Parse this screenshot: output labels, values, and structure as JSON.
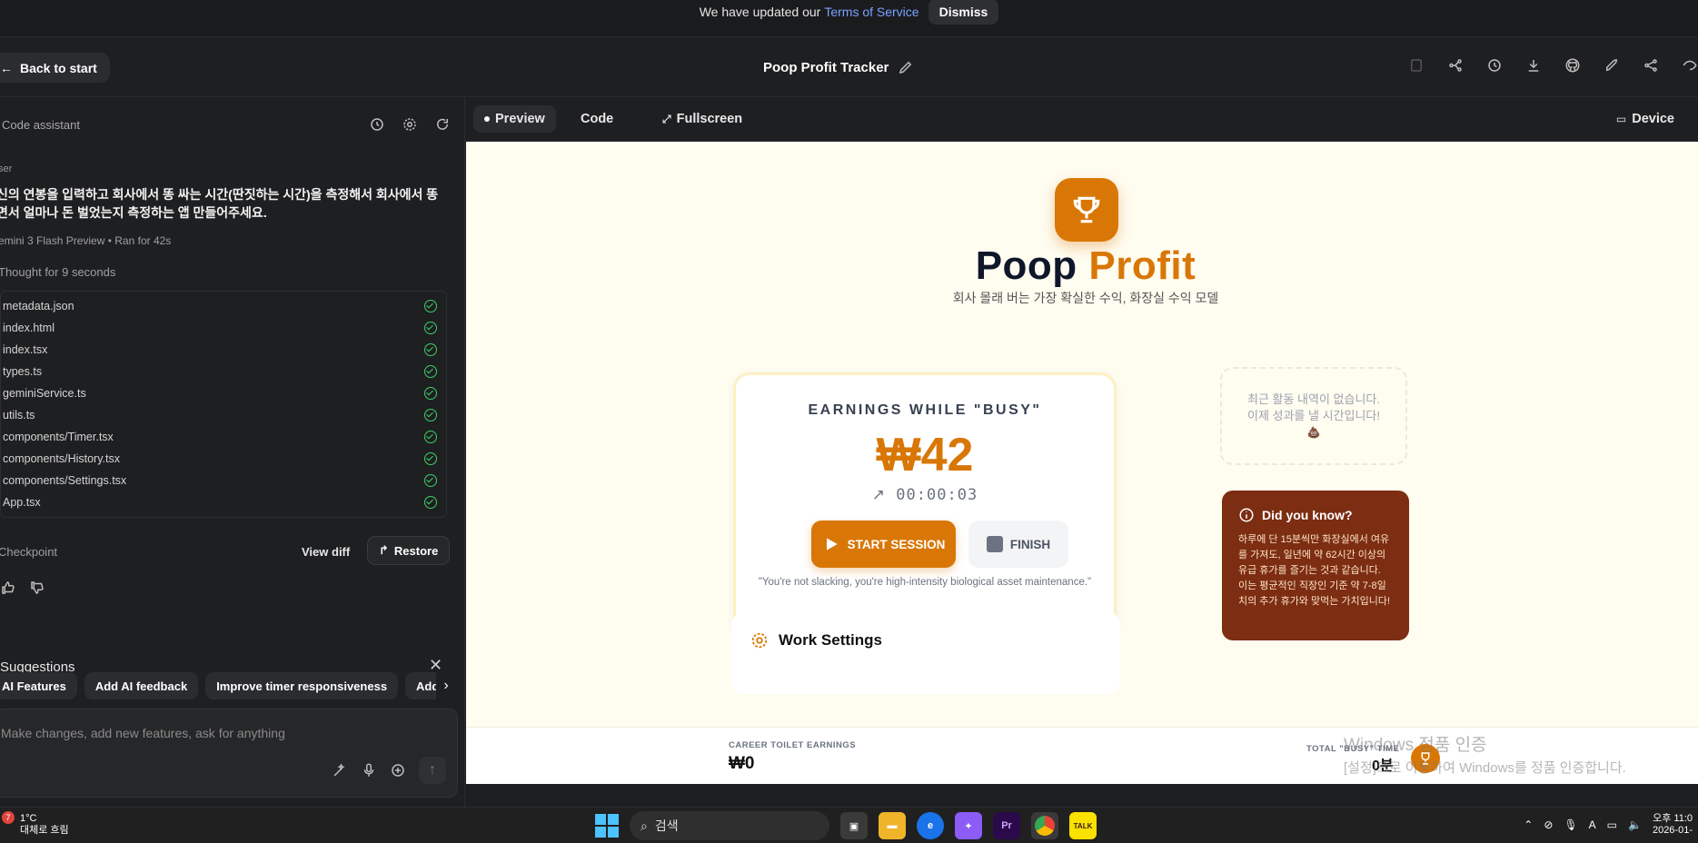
{
  "banner": {
    "text": "We have updated our",
    "link": "Terms of Service",
    "dismiss": "Dismiss"
  },
  "topbar": {
    "back": "Back to start",
    "title": "Poop Profit Tracker"
  },
  "assistant": {
    "title": "Code assistant",
    "user_label": "ser",
    "prompt": "신의 연봉을 입력하고 회사에서 똥 싸는 시간(딴짓하는 시간)을 측정해서 회사에서 똥 면서 얼마나 돈 벌었는지 측정하는 앱 만들어주세요.",
    "model": "emini 3 Flash Preview",
    "ran": "Ran for 42s",
    "thought": "Thought for 9 seconds",
    "files": [
      "metadata.json",
      "index.html",
      "index.tsx",
      "types.ts",
      "geminiService.ts",
      "utils.ts",
      "components/Timer.tsx",
      "components/History.tsx",
      "components/Settings.tsx",
      "App.tsx"
    ],
    "checkpoint": "Checkpoint",
    "view_diff": "View diff",
    "restore": "Restore",
    "suggestions_title": "Suggestions",
    "suggestions": [
      "AI Features",
      "Add AI feedback",
      "Improve timer responsiveness",
      "Add s"
    ],
    "input_placeholder": "Make changes, add new features, ask for anything"
  },
  "preview_tabs": {
    "preview": "Preview",
    "code": "Code",
    "fullscreen": "Fullscreen",
    "device": "Device"
  },
  "app": {
    "title_a": "Poop",
    "title_b": "Profit",
    "subtitle": "회사 몰래 버는 가장 확실한 수익, 화장실 수익 모델",
    "card_label": "EARNINGS WHILE \"BUSY\"",
    "amount": "₩42",
    "elapsed": "00:00:03",
    "start": "START SESSION",
    "finish": "FINISH",
    "quote": "\"You're not slacking, you're high-intensity biological asset maintenance.\"",
    "empty_line1": "최근 활동 내역이 없습니다.",
    "empty_line2": "이제 성과를 낼 시간입니다!",
    "empty_emoji": "💩",
    "did_title": "Did you know?",
    "did_body": "하루에 단 15분씩만 화장실에서 여유를 가져도, 일년에 약 62시간 이상의 유급 휴가를 즐기는 것과 같습니다. 이는 평균적인 직장인 기준 약 7-8일치의 추가 휴가와 맞먹는 가치입니다!",
    "settings_title": "Work Settings",
    "career_label": "CAREER TOILET EARNINGS",
    "career_value": "₩0",
    "total_label": "TOTAL \"BUSY\" TIME",
    "total_value": "0분"
  },
  "watermark": {
    "line1": "Windows 정품 인증",
    "line2": "[설정]으로 이동하여 Windows를 정품 인증합니다."
  },
  "taskbar": {
    "badge": "7",
    "weather_temp": "1°C",
    "weather_desc": "대체로 흐림",
    "search": "검색",
    "premiere": "Pr",
    "kakao": "TALK",
    "ime": "A",
    "time": "오후 11:0",
    "date": "2026-01-"
  },
  "colors": {
    "accent": "#d97706",
    "bg_dark": "#1e1f21",
    "app_bg": "#fffcf0",
    "did_bg": "#7c2d12"
  }
}
